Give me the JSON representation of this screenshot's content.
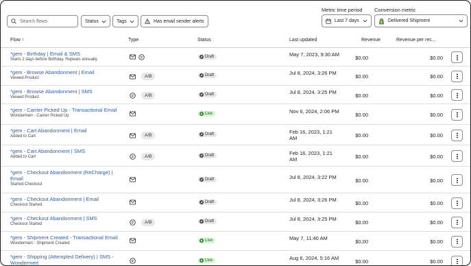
{
  "toolbar": {
    "search_placeholder": "Search flows",
    "status_label": "Status",
    "tags_label": "Tags",
    "alerts_label": "Has email sender alerts",
    "metric_time_label": "Metric time period",
    "metric_time_value": "Last 7 days",
    "conversion_label": "Conversion metric",
    "conversion_value": "Delivered Shipment"
  },
  "columns": {
    "flow": "Flow",
    "sort_arrow": "↑",
    "type": "Type",
    "status": "Status",
    "last_updated": "Last updated",
    "revenue": "Revenue",
    "revenue_per": "Revenue per rec..."
  },
  "rows": [
    {
      "name": "*gem - Birthday | Email & SMS",
      "sub": "Starts 2 days before Birthday. Repeats annually.",
      "types": [
        "email",
        "sms"
      ],
      "ab": "",
      "status": "Draft",
      "updated": "May 7, 2023, 9:30 AM",
      "revenue": "$0.00",
      "revenue_per": "$0.00"
    },
    {
      "name": "*gem - Browse Abandonment | Email",
      "sub": "Viewed Product",
      "types": [
        "email"
      ],
      "ab": "A/B",
      "status": "Draft",
      "updated": "Jul 8, 2024, 3:26 PM",
      "revenue": "$0.00",
      "revenue_per": "$0.00"
    },
    {
      "name": "*gem - Browse Abandonment | SMS",
      "sub": "Viewed Product",
      "types": [
        "sms"
      ],
      "ab": "A/B",
      "status": "Draft",
      "updated": "Jul 8, 2024, 3:25 PM",
      "revenue": "$0.00",
      "revenue_per": "$0.00"
    },
    {
      "name": "*gem - Carrier Picked Up - Transactional Email",
      "sub": "Wondermert - Carrier Picked Up",
      "types": [
        "email"
      ],
      "ab": "",
      "status": "Live",
      "updated": "Nov 6, 2024, 2:06 PM",
      "revenue": "$0.00",
      "revenue_per": "$0.00"
    },
    {
      "name": "*gem - Cart Abandonment | Email",
      "sub": "Added to Cart",
      "types": [
        "email"
      ],
      "ab": "A/B",
      "status": "Draft",
      "updated": "Feb 16, 2023, 1:21 AM",
      "revenue": "$0.00",
      "revenue_per": "$0.00"
    },
    {
      "name": "*gem - Cart Abandonment | SMS",
      "sub": "Added to Cart",
      "types": [
        "sms"
      ],
      "ab": "A/B",
      "status": "Draft",
      "updated": "Feb 16, 2023, 1:21 AM",
      "revenue": "$0.00",
      "revenue_per": "$0.00"
    },
    {
      "name": "*gem - Checkout Abandonment (ReCharge) | Email",
      "sub": "Started Checkout",
      "types": [
        "email"
      ],
      "ab": "",
      "status": "Draft",
      "updated": "Jul 8, 2024, 3:22 PM",
      "revenue": "$0.00",
      "revenue_per": "$0.00"
    },
    {
      "name": "*gem - Checkout Abandonment | Email",
      "sub": "Checkout Started",
      "types": [
        "email"
      ],
      "ab": "",
      "status": "Draft",
      "updated": "Jul 8, 2024, 3:26 PM",
      "revenue": "$0.00",
      "revenue_per": "$0.00"
    },
    {
      "name": "*gem - Checkout Abandonment | SMS",
      "sub": "Checkout Started",
      "types": [
        "sms"
      ],
      "ab": "A/B",
      "status": "Draft",
      "updated": "Jul 8, 2024, 3:25 PM",
      "revenue": "$0.00",
      "revenue_per": "$0.00"
    },
    {
      "name": "*gem - Shipment Created - Transactional Email",
      "sub": "Wondermert - Shipment Created",
      "types": [
        "email"
      ],
      "ab": "",
      "status": "Live",
      "updated": "May 7, 11:40 AM",
      "revenue": "$0.00",
      "revenue_per": "$0.00"
    },
    {
      "name": "*gem - Shipping (Attempted Delivery) | SMS - Wondermert",
      "sub": "",
      "types": [
        "sms"
      ],
      "ab": "",
      "status": "Live",
      "updated": "Aug 6, 2024, 5:16 AM",
      "revenue": "$0.00",
      "revenue_per": "$0.00"
    }
  ]
}
